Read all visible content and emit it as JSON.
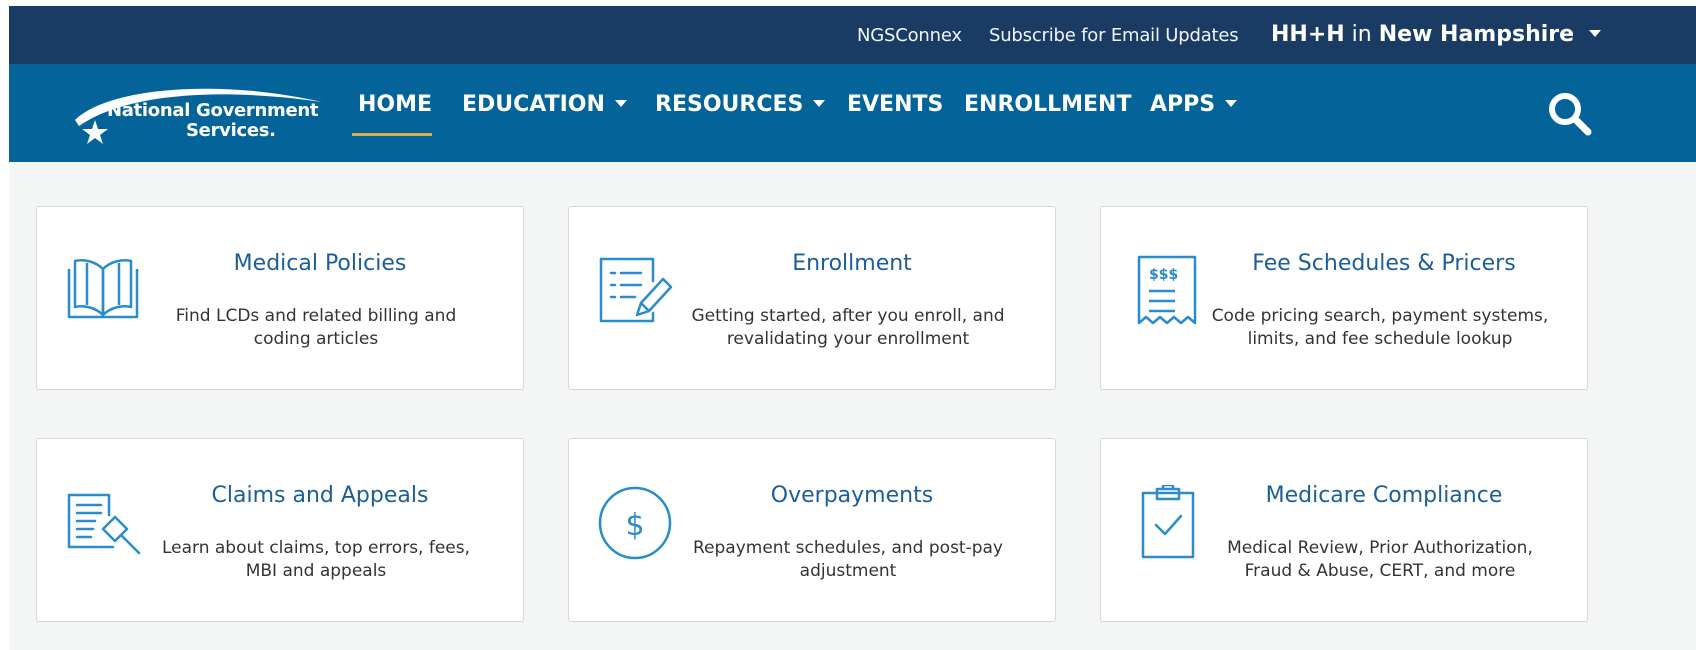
{
  "topbar": {
    "links": [
      "NGSConnex",
      "Subscribe for Email Updates"
    ],
    "region_prefix": "HH+H",
    "region_in": "in",
    "region_state": "New Hampshire"
  },
  "logo": {
    "line1": "National Government",
    "line2": "Services."
  },
  "nav": {
    "items": [
      {
        "label": "HOME",
        "active": true,
        "dropdown": false
      },
      {
        "label": "EDUCATION",
        "dropdown": true
      },
      {
        "label": "RESOURCES",
        "dropdown": true
      },
      {
        "label": "EVENTS",
        "dropdown": false
      },
      {
        "label": "ENROLLMENT",
        "dropdown": false
      },
      {
        "label": "APPS",
        "dropdown": true
      }
    ],
    "search_icon": "search-icon"
  },
  "cards": [
    {
      "title": "Medical Policies",
      "desc": "Find LCDs and related billing and coding articles",
      "icon": "book-icon"
    },
    {
      "title": "Enrollment",
      "desc": "Getting started, after you enroll, and revalidating your enrollment",
      "icon": "document-pencil-icon"
    },
    {
      "title": "Fee Schedules & Pricers",
      "desc": "Code pricing search, payment systems, limits, and fee schedule lookup",
      "icon": "receipt-icon",
      "icon_text": "$$$"
    },
    {
      "title": "Claims and Appeals",
      "desc": "Learn about claims, top errors, fees, MBI and appeals",
      "icon": "gavel-document-icon"
    },
    {
      "title": "Overpayments",
      "desc": "Repayment schedules, and post-pay adjustment",
      "icon": "dollar-circle-icon",
      "icon_text": "$"
    },
    {
      "title": "Medicare Compliance",
      "desc": "Medical Review, Prior Authorization, Fraud & Abuse, CERT, and more",
      "icon": "clipboard-check-icon"
    }
  ],
  "colors": {
    "topbar": "#1a3b63",
    "navbar": "#04649a",
    "accent_underline": "#d9ae50",
    "card_title": "#1b5e9a",
    "icon": "#2a8ccc"
  }
}
